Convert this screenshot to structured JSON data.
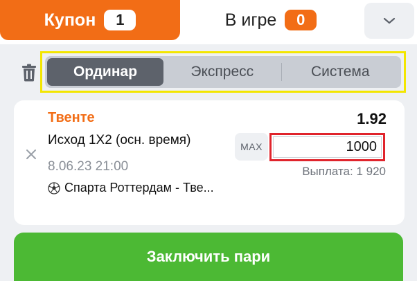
{
  "header": {
    "tabs": [
      {
        "label": "Купон",
        "count": "1",
        "active": true
      },
      {
        "label": "В игре",
        "count": "0",
        "active": false
      }
    ]
  },
  "bet_type": {
    "options": [
      "Ординар",
      "Экспресс",
      "Система"
    ],
    "selected": "Ординар"
  },
  "bet": {
    "team": "Твенте",
    "odds": "1.92",
    "market": "Исход 1Х2 (осн. время)",
    "datetime": "8.06.23 21:00",
    "match": "Спарта Роттердам - Тве...",
    "max_label": "MAX",
    "stake": "1000",
    "payout": "Выплата: 1 920"
  },
  "cta": {
    "label": "Заключить пари"
  },
  "colors": {
    "accent": "#f26d16",
    "cta": "#4cb934",
    "highlight_yellow": "#f3e600",
    "highlight_red": "#e0242c"
  },
  "icons": [
    "chevron-down-icon",
    "trash-icon",
    "close-icon",
    "soccer-ball-icon"
  ]
}
